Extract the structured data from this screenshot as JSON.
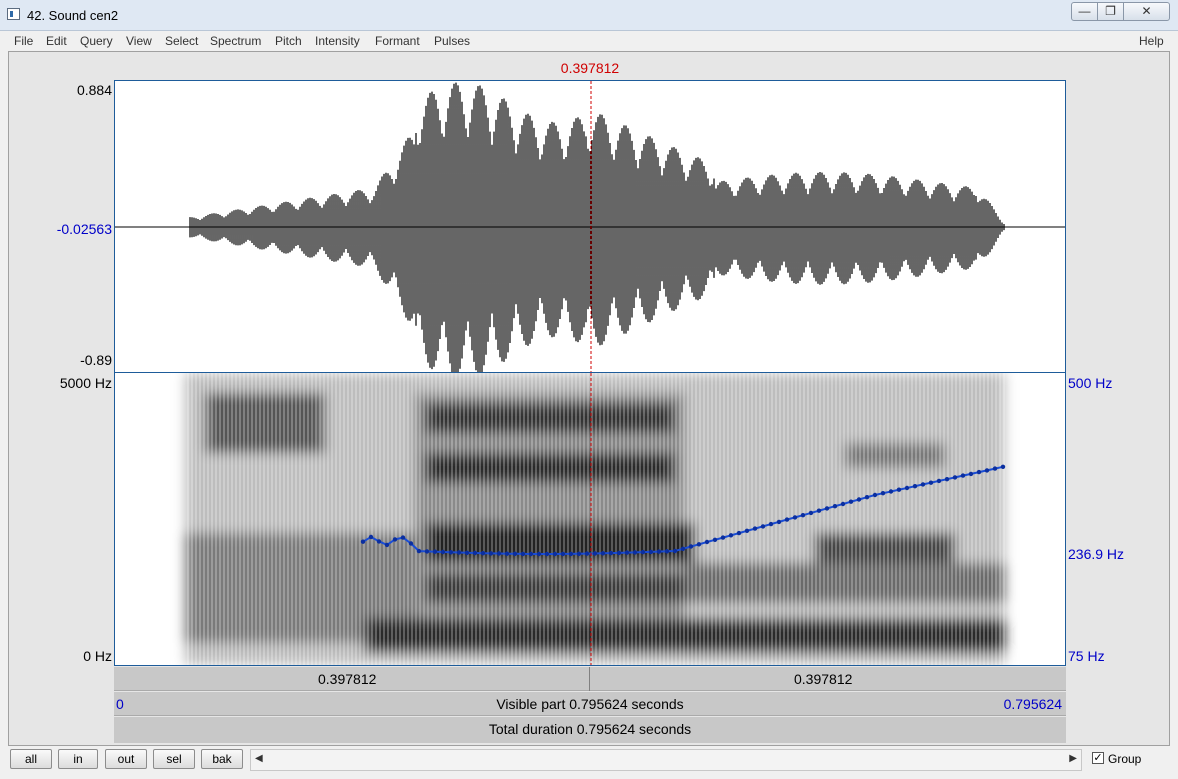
{
  "window": {
    "title": "42. Sound cen2"
  },
  "menu": [
    "File",
    "Edit",
    "Query",
    "View",
    "Select",
    "Spectrum",
    "Pitch",
    "Intensity",
    "Formant",
    "Pulses",
    "Help"
  ],
  "cursor": {
    "time_label": "0.397812"
  },
  "waveform": {
    "max_label": "0.884",
    "mid_label": "-0.02563",
    "min_label": "-0.89"
  },
  "spectrogram": {
    "freq_top_label": "5000 Hz",
    "freq_bottom_label": "0 Hz",
    "pitch_top_label": "500 Hz",
    "pitch_mid_label": "236.9 Hz",
    "pitch_bottom_label": "75 Hz"
  },
  "bars": {
    "left_time": "0.397812",
    "right_time": "0.397812",
    "visible_start": "0",
    "visible_label": "Visible part 0.795624 seconds",
    "visible_end": "0.795624",
    "total_label": "Total duration 0.795624 seconds"
  },
  "buttons": {
    "all": "all",
    "in": "in",
    "out": "out",
    "sel": "sel",
    "bak": "bak"
  },
  "group": {
    "label": "Group",
    "checked": true
  },
  "colors": {
    "cursor": "#d00000",
    "pitch": "#1a4dd6",
    "axis_blue": "#0000c8"
  },
  "icons": {
    "close": "close-icon",
    "maximize": "maximize-icon",
    "minimize": "minimize-icon",
    "scroll_left": "arrow-left-icon",
    "scroll_right": "arrow-right-icon"
  }
}
